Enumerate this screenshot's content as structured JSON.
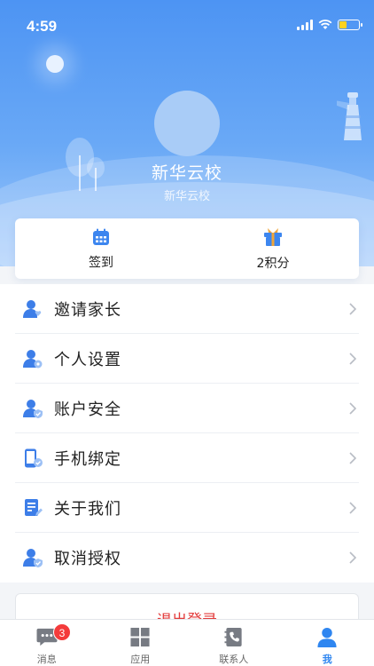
{
  "status_bar": {
    "time": "4:59"
  },
  "profile": {
    "name": "新华云校",
    "subtitle": "新华云校"
  },
  "quick_actions": [
    {
      "label": "签到",
      "icon": "calendar-icon"
    },
    {
      "label": "2积分",
      "icon": "gift-icon"
    }
  ],
  "menu": [
    {
      "label": "邀请家长",
      "icon": "invite-parent-icon"
    },
    {
      "label": "个人设置",
      "icon": "user-settings-icon"
    },
    {
      "label": "账户安全",
      "icon": "account-security-icon"
    },
    {
      "label": "手机绑定",
      "icon": "phone-bind-icon"
    },
    {
      "label": "关于我们",
      "icon": "document-edit-icon"
    },
    {
      "label": "取消授权",
      "icon": "revoke-auth-icon"
    }
  ],
  "logout_label": "退出登录",
  "tabs": [
    {
      "label": "消息",
      "icon": "chat-icon",
      "badge": "3"
    },
    {
      "label": "应用",
      "icon": "grid-apps-icon"
    },
    {
      "label": "联系人",
      "icon": "contacts-phone-icon"
    },
    {
      "label": "我",
      "icon": "person-icon",
      "active": true
    }
  ],
  "colors": {
    "accent": "#2f86f0",
    "header_top": "#4d94f3",
    "logout_text": "#e33b3b",
    "badge": "#f43b3b"
  }
}
